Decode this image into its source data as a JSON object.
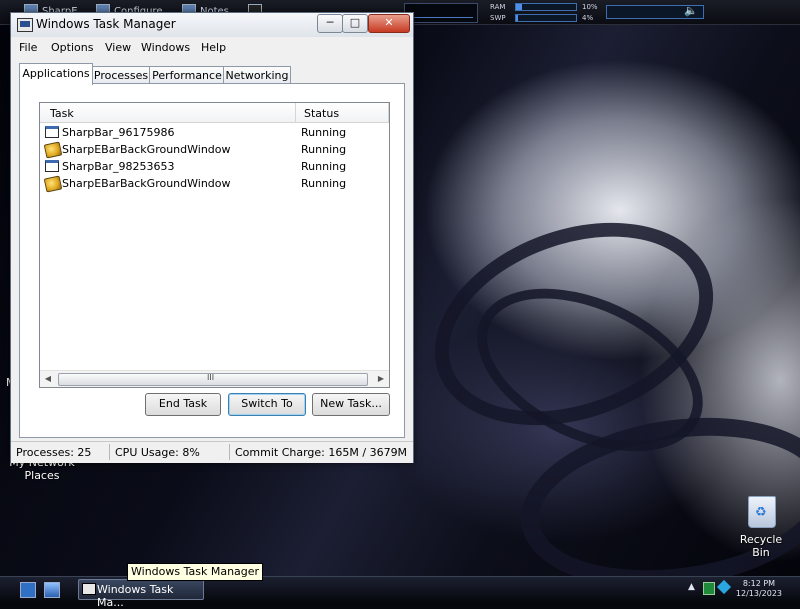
{
  "topbar": {
    "items": [
      {
        "label": "SharpE"
      },
      {
        "label": "Configure"
      },
      {
        "label": "Notes"
      }
    ],
    "ram_label": "RAM",
    "ram_value": "10%",
    "ram_level": 0.1,
    "swp_label": "SWP",
    "swp_value": "4%",
    "swp_level": 0.04
  },
  "desktop": {
    "network_label_line1": "My Network",
    "network_label_line2": "Places",
    "recycle_label": "Recycle Bin",
    "partial_label": "M"
  },
  "window": {
    "title": "Windows Task Manager",
    "controls": {
      "minimize": "─",
      "maximize": "□",
      "close": "✕"
    },
    "menu": [
      "File",
      "Options",
      "View",
      "Windows",
      "Help"
    ],
    "tabs": [
      "Applications",
      "Processes",
      "Performance",
      "Networking"
    ],
    "active_tab": "Applications",
    "columns": {
      "task": "Task",
      "status": "Status"
    },
    "rows": [
      {
        "task": "SharpBar_96175986",
        "status": "Running",
        "icon": "window-icon"
      },
      {
        "task": "SharpEBarBackGroundWindow",
        "status": "Running",
        "icon": "gear-icon"
      },
      {
        "task": "SharpBar_98253653",
        "status": "Running",
        "icon": "window-icon"
      },
      {
        "task": "SharpEBarBackGroundWindow",
        "status": "Running",
        "icon": "gear-icon"
      }
    ],
    "scroll": {
      "left": "◀",
      "right": "▶",
      "grip": "III"
    },
    "buttons": {
      "end_task": "End Task",
      "switch_to": "Switch To",
      "new_task": "New Task..."
    },
    "status": {
      "processes": "Processes: 25",
      "cpu": "CPU Usage: 8%",
      "commit": "Commit Charge: 165M / 3679M"
    }
  },
  "taskbar": {
    "task_button": "Windows Task Ma...",
    "tooltip": "Windows Task Manager",
    "time": "8:12 PM",
    "date": "12/13/2023"
  },
  "colors": {
    "accent": "#3c7fb1",
    "meter": "#4d8ee8"
  }
}
